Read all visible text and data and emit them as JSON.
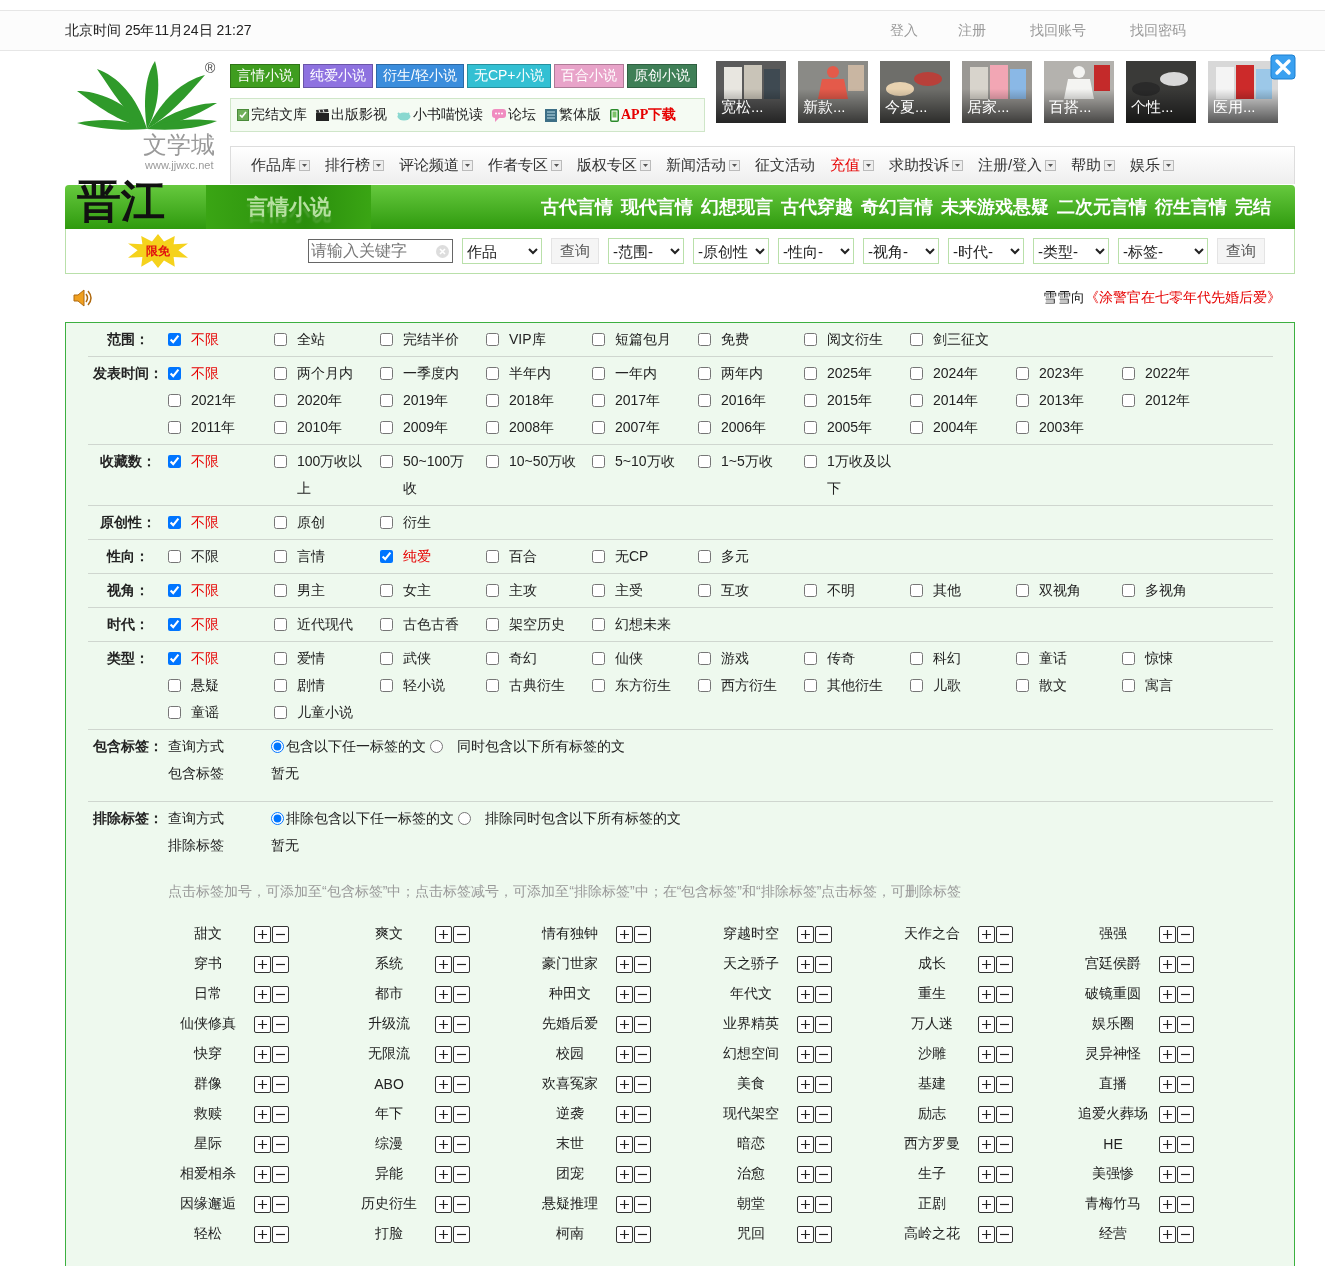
{
  "top_bar": {
    "datetime": "北京时间 25年11月24日 21:27",
    "links": [
      "登入",
      "注册",
      "找回账号",
      "找回密码"
    ]
  },
  "logo": {
    "registered": "®",
    "name": "文学城",
    "url": "www.jjwxc.net",
    "mark": "晋江"
  },
  "channels": [
    {
      "label": "言情小说",
      "color": "#3f9d1f"
    },
    {
      "label": "纯爱小说",
      "color": "#8e72e0"
    },
    {
      "label": "衍生/轻小说",
      "color": "#3b8ddc"
    },
    {
      "label": "无CP+小说",
      "color": "#33c0d3"
    },
    {
      "label": "百合小说",
      "color": "#e8a3c9"
    },
    {
      "label": "原创小说",
      "color": "#3f7f57"
    }
  ],
  "quick_links": [
    {
      "label": "完结文库",
      "kind": "check",
      "highlight": false
    },
    {
      "label": "出版影视",
      "kind": "clapper",
      "highlight": false
    },
    {
      "label": "小书喵悦读",
      "kind": "cat",
      "highlight": false
    },
    {
      "label": "论坛",
      "kind": "chat",
      "highlight": false
    },
    {
      "label": "繁体版",
      "kind": "book",
      "highlight": false
    },
    {
      "label": "APP下载",
      "kind": "phone",
      "highlight": true
    }
  ],
  "ads": [
    {
      "caption": "宽松..."
    },
    {
      "caption": "新款..."
    },
    {
      "caption": "今夏..."
    },
    {
      "caption": "居家..."
    },
    {
      "caption": "百搭..."
    },
    {
      "caption": "个性..."
    },
    {
      "caption": "医用..."
    }
  ],
  "nav": [
    {
      "label": "作品库",
      "dropdown": true,
      "highlight": false
    },
    {
      "label": "排行榜",
      "dropdown": true,
      "highlight": false
    },
    {
      "label": "评论频道",
      "dropdown": true,
      "highlight": false
    },
    {
      "label": "作者专区",
      "dropdown": true,
      "highlight": false
    },
    {
      "label": "版权专区",
      "dropdown": true,
      "highlight": false
    },
    {
      "label": "新闻活动",
      "dropdown": true,
      "highlight": false
    },
    {
      "label": "征文活动",
      "dropdown": false,
      "highlight": false
    },
    {
      "label": "充值",
      "dropdown": true,
      "highlight": true
    },
    {
      "label": "求助投诉",
      "dropdown": true,
      "highlight": false
    },
    {
      "label": "注册/登入",
      "dropdown": true,
      "highlight": false
    },
    {
      "label": "帮助",
      "dropdown": true,
      "highlight": false
    },
    {
      "label": "娱乐",
      "dropdown": true,
      "highlight": false
    }
  ],
  "section_bar": {
    "title": "言情小说",
    "categories": [
      "古代言情",
      "现代言情",
      "幻想现言",
      "古代穿越",
      "奇幻言情",
      "未来游戏悬疑",
      "二次元言情",
      "衍生言情",
      "完结"
    ]
  },
  "search": {
    "badge": "限免",
    "placeholder": "请输入关键字",
    "scope": "作品",
    "button": "查询",
    "selects": [
      "-范围-",
      "-原创性",
      "-性向-",
      "-视角-",
      "-时代-",
      "-类型-",
      "-标签-"
    ],
    "submit": "查询"
  },
  "news": {
    "user": "雪雪向",
    "title": "《涂警官在七零年代先婚后爱》"
  },
  "filters": [
    {
      "label": "范围：",
      "options": [
        {
          "label": "不限",
          "checked": true
        },
        {
          "label": "全站",
          "checked": false
        },
        {
          "label": "完结半价",
          "checked": false
        },
        {
          "label": "VIP库",
          "checked": false
        },
        {
          "label": "短篇包月",
          "checked": false
        },
        {
          "label": "免费",
          "checked": false
        },
        {
          "label": "阅文衍生",
          "checked": false
        },
        {
          "label": "剑三征文",
          "checked": false
        }
      ]
    },
    {
      "label": "发表时间：",
      "options": [
        {
          "label": "不限",
          "checked": true
        },
        {
          "label": "两个月内",
          "checked": false
        },
        {
          "label": "一季度内",
          "checked": false
        },
        {
          "label": "半年内",
          "checked": false
        },
        {
          "label": "一年内",
          "checked": false
        },
        {
          "label": "两年内",
          "checked": false
        },
        {
          "label": "2025年",
          "checked": false
        },
        {
          "label": "2024年",
          "checked": false
        },
        {
          "label": "2023年",
          "checked": false
        },
        {
          "label": "2022年",
          "checked": false
        },
        {
          "label": "2021年",
          "checked": false
        },
        {
          "label": "2020年",
          "checked": false
        },
        {
          "label": "2019年",
          "checked": false
        },
        {
          "label": "2018年",
          "checked": false
        },
        {
          "label": "2017年",
          "checked": false
        },
        {
          "label": "2016年",
          "checked": false
        },
        {
          "label": "2015年",
          "checked": false
        },
        {
          "label": "2014年",
          "checked": false
        },
        {
          "label": "2013年",
          "checked": false
        },
        {
          "label": "2012年",
          "checked": false
        },
        {
          "label": "2011年",
          "checked": false
        },
        {
          "label": "2010年",
          "checked": false
        },
        {
          "label": "2009年",
          "checked": false
        },
        {
          "label": "2008年",
          "checked": false
        },
        {
          "label": "2007年",
          "checked": false
        },
        {
          "label": "2006年",
          "checked": false
        },
        {
          "label": "2005年",
          "checked": false
        },
        {
          "label": "2004年",
          "checked": false
        },
        {
          "label": "2003年",
          "checked": false
        }
      ]
    },
    {
      "label": "收藏数：",
      "options": [
        {
          "label": "不限",
          "checked": true
        },
        {
          "label": "100万收以上",
          "checked": false
        },
        {
          "label": "50~100万收",
          "checked": false
        },
        {
          "label": "10~50万收",
          "checked": false
        },
        {
          "label": "5~10万收",
          "checked": false
        },
        {
          "label": "1~5万收",
          "checked": false
        },
        {
          "label": "1万收及以下",
          "checked": false
        }
      ]
    },
    {
      "label": "原创性：",
      "options": [
        {
          "label": "不限",
          "checked": true
        },
        {
          "label": "原创",
          "checked": false
        },
        {
          "label": "衍生",
          "checked": false
        }
      ]
    },
    {
      "label": "性向：",
      "options": [
        {
          "label": "不限",
          "checked": false
        },
        {
          "label": "言情",
          "checked": false
        },
        {
          "label": "纯爱",
          "checked": true
        },
        {
          "label": "百合",
          "checked": false
        },
        {
          "label": "无CP",
          "checked": false
        },
        {
          "label": "多元",
          "checked": false
        }
      ]
    },
    {
      "label": "视角：",
      "options": [
        {
          "label": "不限",
          "checked": true
        },
        {
          "label": "男主",
          "checked": false
        },
        {
          "label": "女主",
          "checked": false
        },
        {
          "label": "主攻",
          "checked": false
        },
        {
          "label": "主受",
          "checked": false
        },
        {
          "label": "互攻",
          "checked": false
        },
        {
          "label": "不明",
          "checked": false
        },
        {
          "label": "其他",
          "checked": false
        },
        {
          "label": "双视角",
          "checked": false
        },
        {
          "label": "多视角",
          "checked": false
        }
      ]
    },
    {
      "label": "时代：",
      "options": [
        {
          "label": "不限",
          "checked": true
        },
        {
          "label": "近代现代",
          "checked": false
        },
        {
          "label": "古色古香",
          "checked": false
        },
        {
          "label": "架空历史",
          "checked": false
        },
        {
          "label": "幻想未来",
          "checked": false
        }
      ]
    },
    {
      "label": "类型：",
      "options": [
        {
          "label": "不限",
          "checked": true
        },
        {
          "label": "爱情",
          "checked": false
        },
        {
          "label": "武侠",
          "checked": false
        },
        {
          "label": "奇幻",
          "checked": false
        },
        {
          "label": "仙侠",
          "checked": false
        },
        {
          "label": "游戏",
          "checked": false
        },
        {
          "label": "传奇",
          "checked": false
        },
        {
          "label": "科幻",
          "checked": false
        },
        {
          "label": "童话",
          "checked": false
        },
        {
          "label": "惊悚",
          "checked": false
        },
        {
          "label": "悬疑",
          "checked": false
        },
        {
          "label": "剧情",
          "checked": false
        },
        {
          "label": "轻小说",
          "checked": false
        },
        {
          "label": "古典衍生",
          "checked": false
        },
        {
          "label": "东方衍生",
          "checked": false
        },
        {
          "label": "西方衍生",
          "checked": false
        },
        {
          "label": "其他衍生",
          "checked": false
        },
        {
          "label": "儿歌",
          "checked": false
        },
        {
          "label": "散文",
          "checked": false
        },
        {
          "label": "寓言",
          "checked": false
        },
        {
          "label": "童谣",
          "checked": false
        },
        {
          "label": "儿童小说",
          "checked": false
        }
      ]
    }
  ],
  "tag_filters": [
    {
      "label": "包含标签：",
      "mode_label": "查询方式",
      "modes": [
        {
          "label": "包含以下任一标签的文",
          "selected": true
        },
        {
          "label": "同时包含以下所有标签的文",
          "selected": false
        }
      ],
      "list_label": "包含标签",
      "list_value": "暂无"
    },
    {
      "label": "排除标签：",
      "mode_label": "查询方式",
      "modes": [
        {
          "label": "排除包含以下任一标签的文",
          "selected": true
        },
        {
          "label": "排除同时包含以下所有标签的文",
          "selected": false
        }
      ],
      "list_label": "排除标签",
      "list_value": "暂无"
    }
  ],
  "hint": "点击标签加号，可添加至“包含标签”中；点击标签减号，可添加至“排除标签”中；在“包含标签”和“排除标签”点击标签，可删除标签",
  "tags": [
    "甜文",
    "爽文",
    "情有独钟",
    "穿越时空",
    "天作之合",
    "强强",
    "穿书",
    "系统",
    "豪门世家",
    "天之骄子",
    "成长",
    "宫廷侯爵",
    "日常",
    "都市",
    "种田文",
    "年代文",
    "重生",
    "破镜重圆",
    "仙侠修真",
    "升级流",
    "先婚后爱",
    "业界精英",
    "万人迷",
    "娱乐圈",
    "快穿",
    "无限流",
    "校园",
    "幻想空间",
    "沙雕",
    "灵异神怪",
    "群像",
    "ABO",
    "欢喜冤家",
    "美食",
    "基建",
    "直播",
    "救赎",
    "年下",
    "逆袭",
    "现代架空",
    "励志",
    "追爱火葬场",
    "星际",
    "综漫",
    "末世",
    "暗恋",
    "西方罗曼",
    "HE",
    "相爱相杀",
    "异能",
    "团宠",
    "治愈",
    "生子",
    "美强惨",
    "因缘邂逅",
    "历史衍生",
    "悬疑推理",
    "朝堂",
    "正剧",
    "青梅竹马",
    "轻松",
    "打脸",
    "柯南",
    "咒回",
    "高岭之花",
    "经营"
  ]
}
